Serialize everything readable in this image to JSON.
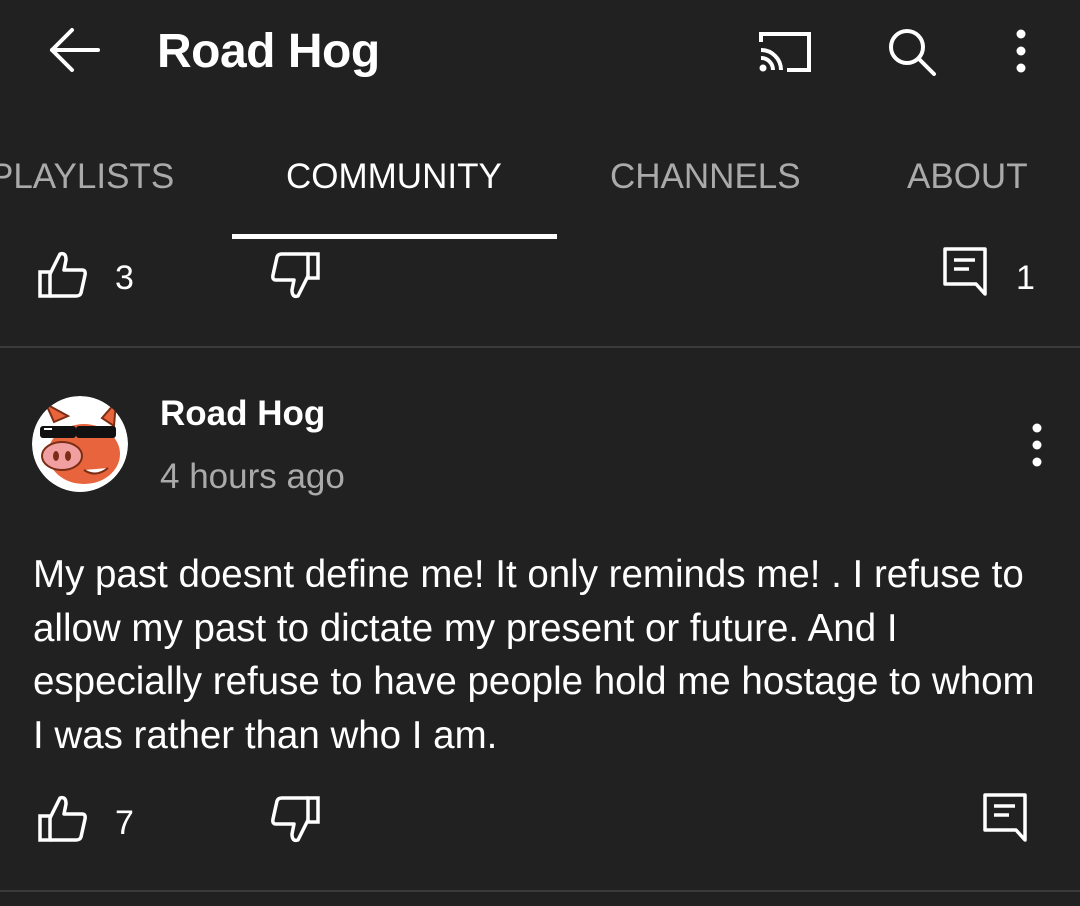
{
  "header": {
    "title": "Road Hog",
    "icons": [
      "back-arrow-icon",
      "cast-icon",
      "search-icon",
      "more-vert-icon"
    ]
  },
  "tabs": [
    {
      "label": "PLAYLISTS",
      "active": false
    },
    {
      "label": "COMMUNITY",
      "active": true
    },
    {
      "label": "CHANNELS",
      "active": false
    },
    {
      "label": "ABOUT",
      "active": false
    }
  ],
  "previous_post": {
    "likes": "3",
    "comments": "1"
  },
  "post": {
    "author": "Road Hog",
    "time": "4 hours ago",
    "text": "My past doesnt define me! It only reminds me! . I refuse to allow my past to dictate my present or future. And I especially refuse to have people hold me hostage to whom I was rather than who I am.",
    "likes": "7"
  },
  "colors": {
    "background": "#212121",
    "text_primary": "#ffffff",
    "text_secondary": "#aaaaaa",
    "divider": "#3a3a3a",
    "avatar_pig": "#e8643c"
  }
}
